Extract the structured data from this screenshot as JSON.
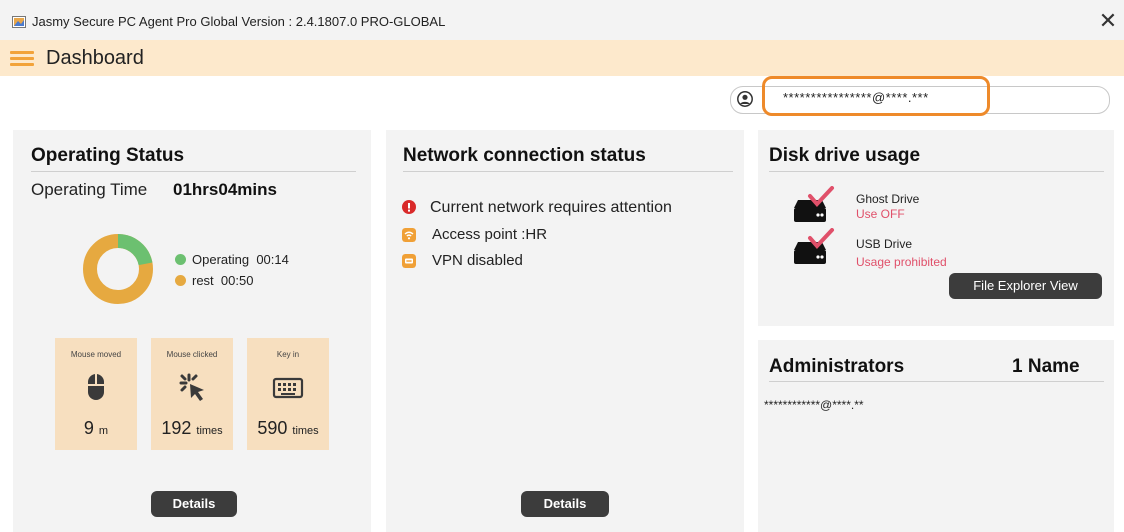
{
  "window": {
    "title": "Jasmy Secure PC Agent Pro Global Version : 2.4.1807.0 PRO-GLOBAL",
    "close_glyph": "✕"
  },
  "header": {
    "title": "Dashboard"
  },
  "user": {
    "email": "****************@****.***"
  },
  "operating": {
    "title": "Operating Status",
    "time_label": "Operating Time",
    "time_value": "01hrs04mins",
    "legend": [
      {
        "label": "Operating",
        "value": "00:14",
        "color": "#6cc070"
      },
      {
        "label": "rest",
        "value": "00:50",
        "color": "#e6a940"
      }
    ],
    "operating_fraction": 0.22,
    "stats": [
      {
        "label": "Mouse moved",
        "value": "9",
        "unit": "m",
        "icon": "mouse-icon"
      },
      {
        "label": "Mouse clicked",
        "value": "192",
        "unit": "times",
        "icon": "click-icon"
      },
      {
        "label": "Key in",
        "value": "590",
        "unit": "times",
        "icon": "keyboard-icon"
      }
    ],
    "details_label": "Details"
  },
  "network": {
    "title": "Network connection status",
    "items": [
      {
        "text": "Current network requires attention",
        "icon": "alert-icon"
      },
      {
        "text": "Access point :HR",
        "icon": "wifi-icon"
      },
      {
        "text": "VPN disabled",
        "icon": "vpn-icon"
      }
    ],
    "details_label": "Details"
  },
  "disk": {
    "title": "Disk drive usage",
    "drives": [
      {
        "name": "Ghost Drive",
        "status": "Use OFF"
      },
      {
        "name": "USB Drive",
        "status": "Usage prohibited"
      }
    ],
    "explorer_label": "File Explorer View"
  },
  "admins": {
    "title": "Administrators",
    "count": "1 Name",
    "emails": [
      "************@****.**"
    ]
  },
  "colors": {
    "accent_orange": "#f2a33a",
    "header_bg": "#fde9cc",
    "operating_green": "#6cc070",
    "rest_orange": "#e6a940",
    "status_red": "#e0506a"
  }
}
